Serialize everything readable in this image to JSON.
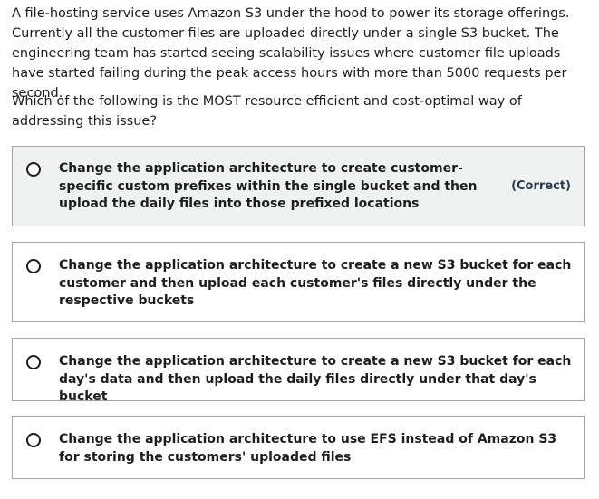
{
  "question": {
    "text": "A file-hosting service uses Amazon S3 under the hood to power its storage offerings. Currently all the customer files are uploaded directly under a single S3 bucket. The engineering team has started seeing scalability issues where customer file uploads have started failing during the peak access hours with more than 5000 requests per second.",
    "prompt": "Which of the following is the MOST resource efficient and cost-optimal way of addressing this issue?"
  },
  "options": [
    {
      "text": "Change the application architecture to create customer-specific custom prefixes within the single bucket and then upload the daily files into those prefixed locations",
      "tag": "(Correct)"
    },
    {
      "text": "Change the application architecture to create a new S3 bucket for each customer and then upload each customer's files directly under the respective buckets"
    },
    {
      "text": "Change the application architecture to create a new S3 bucket for each day's data and then upload the daily files directly under that day's bucket"
    },
    {
      "text": "Change the application architecture to use EFS instead of Amazon S3 for storing the customers' uploaded files"
    }
  ],
  "colors": {
    "border": "#9fa3a7",
    "correct_background": "#eef3f2",
    "text": "#1c1d1f"
  }
}
